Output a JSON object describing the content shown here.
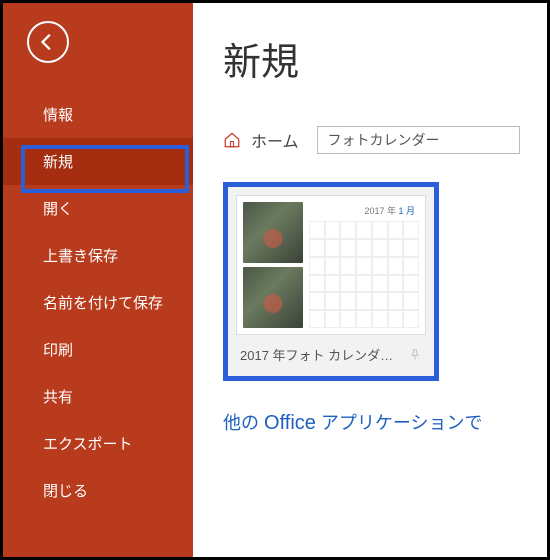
{
  "sidebar": {
    "items": [
      {
        "label": "情報"
      },
      {
        "label": "新規"
      },
      {
        "label": "開く"
      },
      {
        "label": "上書き保存"
      },
      {
        "label": "名前を付けて保存"
      },
      {
        "label": "印刷"
      },
      {
        "label": "共有"
      },
      {
        "label": "エクスポート"
      },
      {
        "label": "閉じる"
      }
    ],
    "activeIndex": 1
  },
  "main": {
    "title": "新規",
    "home_label": "ホーム",
    "search_value": "フォトカレンダー",
    "template": {
      "caption": "2017 年フォト カレンダ…",
      "cal_year": "2017 年",
      "cal_month": "1 月"
    },
    "other_apps_prefix": "他の ",
    "other_apps_office": "Office",
    "other_apps_suffix": " アプリケーションで"
  }
}
